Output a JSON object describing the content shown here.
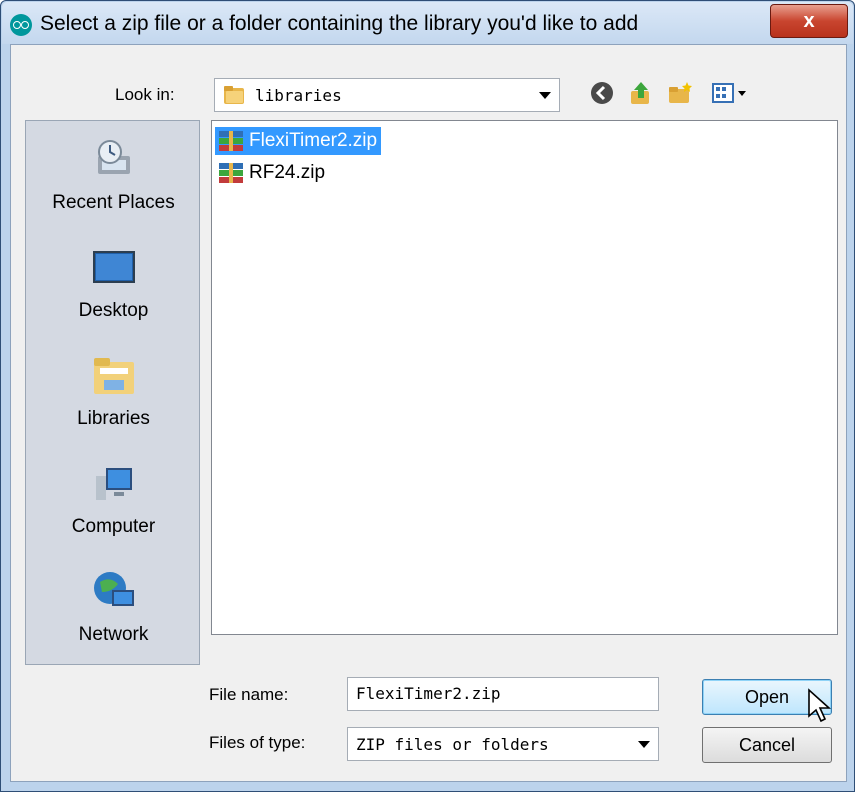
{
  "window": {
    "title": "Select a zip file or a folder containing the library you'd like to add",
    "close_label": "x"
  },
  "toolbar": {
    "look_in_label": "Look in:",
    "look_in_value": "libraries",
    "icons": [
      "back-icon",
      "up-folder-icon",
      "new-folder-icon",
      "view-menu-icon"
    ]
  },
  "places": [
    {
      "label": "Recent Places",
      "icon": "recent-places-icon"
    },
    {
      "label": "Desktop",
      "icon": "desktop-icon"
    },
    {
      "label": "Libraries",
      "icon": "libraries-icon"
    },
    {
      "label": "Computer",
      "icon": "computer-icon"
    },
    {
      "label": "Network",
      "icon": "network-icon"
    }
  ],
  "files": [
    {
      "name": "FlexiTimer2.zip",
      "selected": true
    },
    {
      "name": "RF24.zip",
      "selected": false
    }
  ],
  "form": {
    "file_name_label": "File name:",
    "file_name_value": "FlexiTimer2.zip",
    "file_type_label": "Files of type:",
    "file_type_value": "ZIP files or folders"
  },
  "buttons": {
    "open": "Open",
    "cancel": "Cancel"
  },
  "colors": {
    "selection": "#3399ff",
    "arduino_teal": "#00979c",
    "close_red": "#c9452f"
  }
}
